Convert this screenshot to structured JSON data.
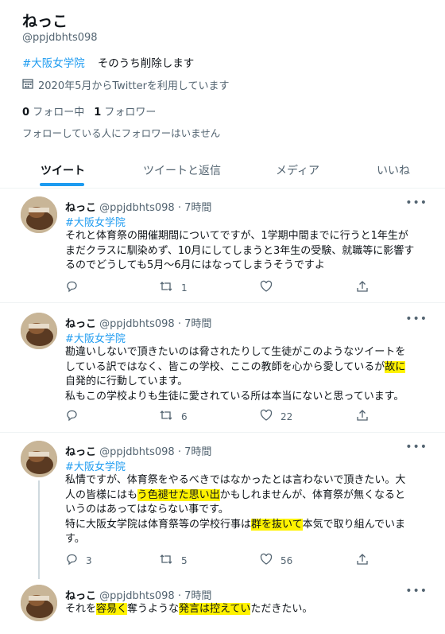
{
  "profile": {
    "name": "ねっこ",
    "handle": "@ppjdbhts098",
    "bio_tag": "#大阪女学院",
    "bio_text": "そのうち削除します",
    "joined": "2020年5月からTwitterを利用しています",
    "following_count": "0",
    "following_label": "フォロー中",
    "followers_count": "1",
    "followers_label": "フォロワー",
    "no_followers_note": "フォローしている人にフォロワーはいません"
  },
  "tabs": [
    "ツイート",
    "ツイートと返信",
    "メディア",
    "いいね"
  ],
  "tweets": [
    {
      "name": "ねっこ",
      "meta": "@ppjdbhts098 · 7時間",
      "tag": "#大阪女学院",
      "lines": [
        "それと体育祭の開催期間についてですが、1学期中間までに行うと1年生が",
        "まだクラスに馴染めず、10月にしてしまうと3年生の受験、就職等に影響す",
        "るのでどうしても5月〜6月にはなってしまうそうですよ"
      ],
      "replies": "",
      "retweets": "1",
      "likes": ""
    },
    {
      "name": "ねっこ",
      "meta": "@ppjdbhts098 · 7時間",
      "tag": "#大阪女学院",
      "line1": "勘違いしないで頂きたいのは脅されたりして生徒がこのようなツイートを",
      "line2_a": "している訳ではなく、皆この学校、ここの教師を心から愛しているが",
      "line2_hl": "故に",
      "line3": "自発的に行動しています。",
      "line4": "私もこの学校よりも生徒に愛されている所は本当にないと思っています。",
      "replies": "",
      "retweets": "6",
      "likes": "22"
    },
    {
      "name": "ねっこ",
      "meta": "@ppjdbhts098 · 7時間",
      "tag": "#大阪女学院",
      "line1": "私情ですが、体育祭をやるべきではなかったとは言わないで頂きたい。大",
      "line2_a": "人の皆様にはも",
      "line2_hl": "う色褪せた思い出",
      "line2_b": "かもしれませんが、体育祭が無くなると",
      "line3": "いうのはあってはならない事です。",
      "line4_a": "特に大阪女学院は体育祭等の学校行事は",
      "line4_hl": "群を抜いて",
      "line4_b": "本気で取り組んでいま",
      "line5": "す。",
      "replies": "3",
      "retweets": "5",
      "likes": "56"
    },
    {
      "name": "ねっこ",
      "meta": "@ppjdbhts098 · 7時間",
      "line_a": "それを",
      "line_hl1": "容易く",
      "line_b": "奪うような",
      "line_hl2": "発言は控えてい",
      "line_c": "ただきたい。"
    }
  ],
  "icons": [
    "calendar-icon",
    "reply-icon",
    "retweet-icon",
    "like-icon",
    "share-icon",
    "more-icon"
  ],
  "colors": {
    "accent": "#1d9bf0",
    "highlight": "#fff200",
    "text": "#0f1419",
    "muted": "#536471"
  }
}
